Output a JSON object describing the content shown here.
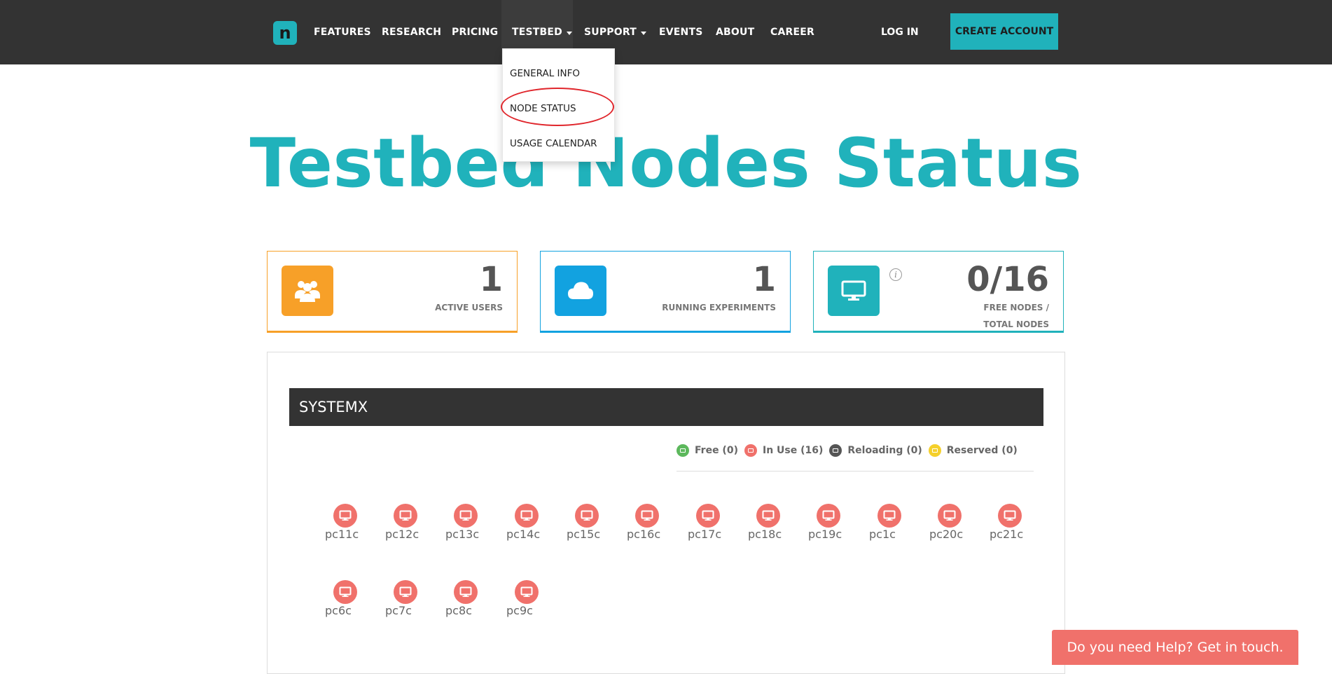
{
  "brand": {
    "logo_letter": "n",
    "accent": "#20b2bb"
  },
  "nav": {
    "items": [
      {
        "label": "FEATURES",
        "has_caret": false
      },
      {
        "label": "RESEARCH",
        "has_caret": false
      },
      {
        "label": "PRICING",
        "has_caret": false
      },
      {
        "label": "TESTBED",
        "has_caret": true,
        "active": true
      },
      {
        "label": "SUPPORT",
        "has_caret": true
      },
      {
        "label": "EVENTS",
        "has_caret": false
      },
      {
        "label": "ABOUT",
        "has_caret": false
      },
      {
        "label": "CAREER",
        "has_caret": false
      }
    ],
    "login_label": "LOG IN",
    "create_account_label": "CREATE ACCOUNT"
  },
  "dropdown": {
    "items": [
      "GENERAL INFO",
      "NODE STATUS",
      "USAGE CALENDAR"
    ],
    "highlighted": "NODE STATUS"
  },
  "page": {
    "title": "Testbed Nodes Status"
  },
  "stats": [
    {
      "value": "1",
      "label_lines": [
        "ACTIVE USERS"
      ],
      "color": "#f7a028",
      "icon": "users-icon"
    },
    {
      "value": "1",
      "label_lines": [
        "RUNNING EXPERIMENTS"
      ],
      "color": "#12a2e0",
      "icon": "cloud-icon"
    },
    {
      "value": "0/16",
      "label_lines": [
        "FREE NODES /",
        "TOTAL NODES"
      ],
      "color": "#20b2bb",
      "icon": "monitor-icon",
      "info_icon": "info-icon"
    }
  ],
  "section": {
    "title": "SYSTEMX"
  },
  "legend": [
    {
      "label": "Free (0)",
      "color": "#5cb85c"
    },
    {
      "label": "In Use (16)",
      "color": "#f0716b"
    },
    {
      "label": "Reloading (0)",
      "color": "#555555"
    },
    {
      "label": "Reserved (0)",
      "color": "#f5d02b"
    }
  ],
  "nodes": [
    {
      "name": "pc11c",
      "status": "in-use"
    },
    {
      "name": "pc12c",
      "status": "in-use"
    },
    {
      "name": "pc13c",
      "status": "in-use"
    },
    {
      "name": "pc14c",
      "status": "in-use"
    },
    {
      "name": "pc15c",
      "status": "in-use"
    },
    {
      "name": "pc16c",
      "status": "in-use"
    },
    {
      "name": "pc17c",
      "status": "in-use"
    },
    {
      "name": "pc18c",
      "status": "in-use"
    },
    {
      "name": "pc19c",
      "status": "in-use"
    },
    {
      "name": "pc1c",
      "status": "in-use"
    },
    {
      "name": "pc20c",
      "status": "in-use"
    },
    {
      "name": "pc21c",
      "status": "in-use"
    },
    {
      "name": "pc6c",
      "status": "in-use"
    },
    {
      "name": "pc7c",
      "status": "in-use"
    },
    {
      "name": "pc8c",
      "status": "in-use"
    },
    {
      "name": "pc9c",
      "status": "in-use"
    }
  ],
  "help": {
    "label": "Do you need Help? Get in touch."
  }
}
